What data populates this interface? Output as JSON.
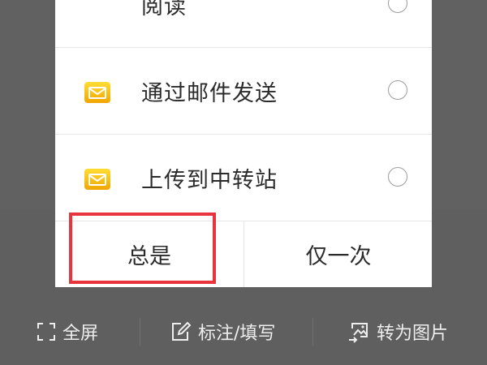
{
  "dialog": {
    "options": [
      {
        "label": "阅读",
        "icon": "none",
        "selected": false
      },
      {
        "label": "通过邮件发送",
        "icon": "mail-icon",
        "selected": false
      },
      {
        "label": "上传到中转站",
        "icon": "mail-icon",
        "selected": false
      }
    ],
    "buttons": {
      "always": "总是",
      "once": "仅一次"
    },
    "highlight_color": "#e8343c"
  },
  "toolbar": {
    "fullscreen": "全屏",
    "annotate": "标注/填写",
    "to_image": "转为图片"
  }
}
